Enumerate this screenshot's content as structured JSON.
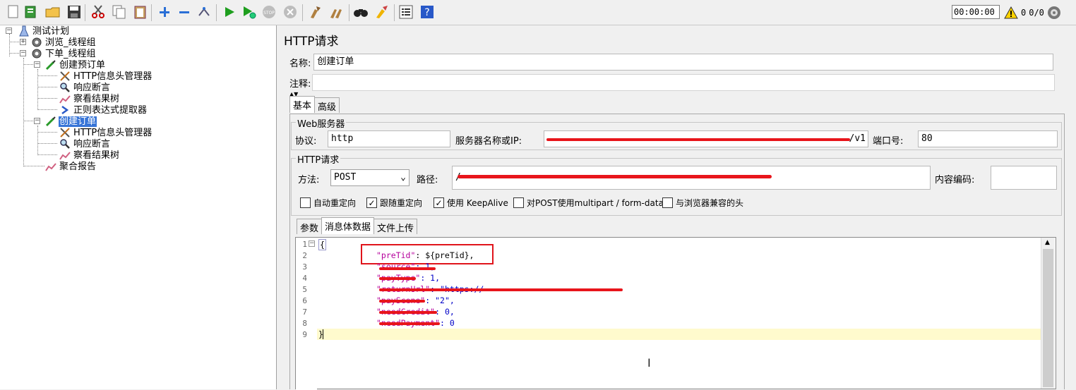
{
  "toolbar": {
    "timer": "00:00:00",
    "warnings": "0",
    "threads": "0/0",
    "icons": [
      "new-icon",
      "templates-icon",
      "open-icon",
      "save-icon",
      "cut-icon",
      "copy-icon",
      "paste-icon",
      "expand-icon",
      "collapse-icon",
      "toggle-icon",
      "start-icon",
      "start-no-pause-icon",
      "stop-icon",
      "shutdown-icon",
      "clear-icon",
      "clear-all-icon",
      "search-icon",
      "reset-search-icon",
      "function-helper-icon",
      "help-icon"
    ]
  },
  "tree": {
    "root": "测试计划",
    "items": [
      {
        "label": "浏览_线程组"
      },
      {
        "label": "下单_线程组"
      },
      {
        "label": "创建预订单"
      },
      {
        "label": "HTTP信息头管理器"
      },
      {
        "label": "响应断言"
      },
      {
        "label": "察看结果树"
      },
      {
        "label": "正则表达式提取器"
      },
      {
        "label": "创建订单"
      },
      {
        "label": "HTTP信息头管理器"
      },
      {
        "label": "响应断言"
      },
      {
        "label": "察看结果树"
      },
      {
        "label": "聚合报告"
      }
    ]
  },
  "panel": {
    "title": "HTTP请求",
    "name_label": "名称:",
    "name_value": "创建订单",
    "comment_label": "注释:",
    "comment_value": "",
    "tabs": [
      "基本",
      "高级"
    ],
    "web_server": {
      "title": "Web服务器",
      "protocol_label": "协议:",
      "protocol_value": "http",
      "server_label": "服务器名称或IP:",
      "server_suffix": "/v1",
      "port_label": "端口号:",
      "port_value": "80"
    },
    "http_request": {
      "title": "HTTP请求",
      "method_label": "方法:",
      "method_value": "POST",
      "path_label": "路径:",
      "path_prefix": "/",
      "encoding_label": "内容编码:",
      "encoding_value": ""
    },
    "checkboxes": [
      {
        "label": "自动重定向",
        "checked": false
      },
      {
        "label": "跟随重定向",
        "checked": true
      },
      {
        "label": "使用 KeepAlive",
        "checked": true
      },
      {
        "label": "对POST使用multipart / form-data",
        "checked": false
      },
      {
        "label": "与浏览器兼容的头",
        "checked": false
      }
    ],
    "body_tabs": [
      "参数",
      "消息体数据",
      "文件上传"
    ],
    "code": {
      "line_numbers": [
        "1",
        "2",
        "3",
        "4",
        "5",
        "6",
        "7",
        "8",
        "9"
      ],
      "l1": "{",
      "l2_key": "\"preTid\"",
      "l2_rest": ": ${preTid},",
      "l3_key": "\"source\"",
      "l3_rest": ": 1,",
      "l4_key": "\"payType\"",
      "l4_rest": ": 1,",
      "l5_key": "\"returnUrl\"",
      "l5_rest": ": \"https://",
      "l6_key": "\"payScene\"",
      "l6_rest": ": \"2\",",
      "l7_key": "\"needCredit\"",
      "l7_rest": ": 0,",
      "l8_key": "\"needPayment\"",
      "l8_rest": ": 0",
      "l9": "}"
    }
  },
  "colors": {
    "selection": "#3875d7",
    "redaction": "#e8151b",
    "highlight_box": "#e0141b",
    "current_line": "#fffacd",
    "json_key": "#b5009c",
    "json_value": "#0000c8"
  }
}
